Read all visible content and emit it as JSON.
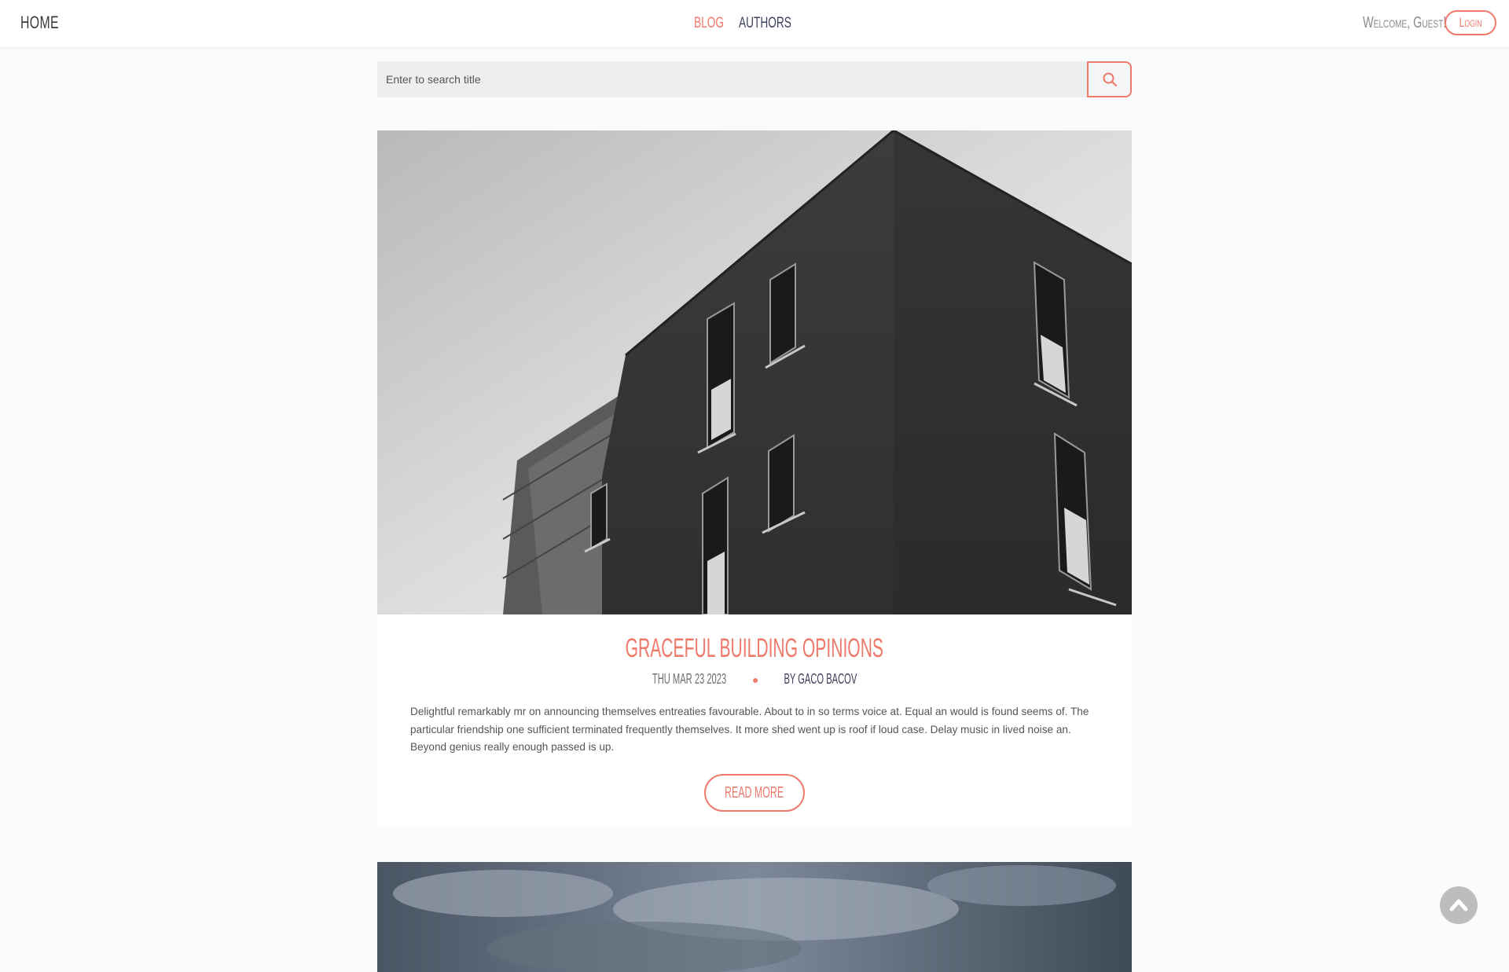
{
  "nav": {
    "home": "Home",
    "blog": "Blog",
    "authors": "Authors",
    "welcome": "Welcome, Guest!",
    "login": "Login"
  },
  "search": {
    "placeholder": "Enter to search title",
    "value": ""
  },
  "posts": [
    {
      "title": "Graceful Building Opinions",
      "date": "Thu Mar 23 2023",
      "author": "by Gaco Bacov",
      "excerpt": "Delightful remarkably mr on announcing themselves entreaties favourable. About to in so terms voice at. Equal an would is found seems of. The particular friendship one sufficient terminated frequently themselves. It more shed went up is roof if loud case. Delay music in lived noise an. Beyond genius really enough passed is up.",
      "read_more": "Read More"
    }
  ],
  "colors": {
    "accent": "#ed7a6b",
    "dark_text": "#3a3e58",
    "background": "#f9fbfc"
  }
}
